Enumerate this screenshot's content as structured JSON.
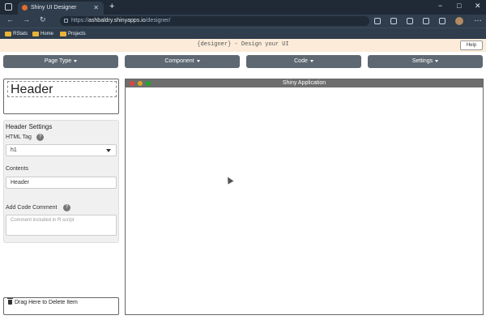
{
  "browser": {
    "tab_title": "Shiny UI Designer",
    "new_tab_icon": "+",
    "url_prefix": "https://",
    "url_host": "ashbaldry.shinyapps.io",
    "url_path": "/designer/",
    "bookmarks": [
      "RStats",
      "Home",
      "Projects"
    ],
    "window_controls": [
      "−",
      "□",
      "✕"
    ],
    "nav": [
      "←",
      "→",
      "↻"
    ],
    "ellipsis": "…"
  },
  "app": {
    "brand": "{designer} - Design your UI",
    "help_label": "Help",
    "menu": [
      "Page Type",
      "Component",
      "Code",
      "Settings"
    ]
  },
  "left": {
    "header_preview_text": "Header",
    "settings_title": "Header Settings",
    "html_tag_label": "HTML Tag",
    "html_tag_value": "h1",
    "contents_label": "Contents",
    "contents_value": "Header",
    "comment_label": "Add Code Comment",
    "comment_placeholder": "Comment included in R script",
    "help_icon_glyph": "?",
    "trash_label": "Drag Here to Delete Item"
  },
  "preview": {
    "title": "Shiny Application",
    "dot_colors": [
      "#e0443e",
      "#dea123",
      "#1aab29"
    ]
  }
}
